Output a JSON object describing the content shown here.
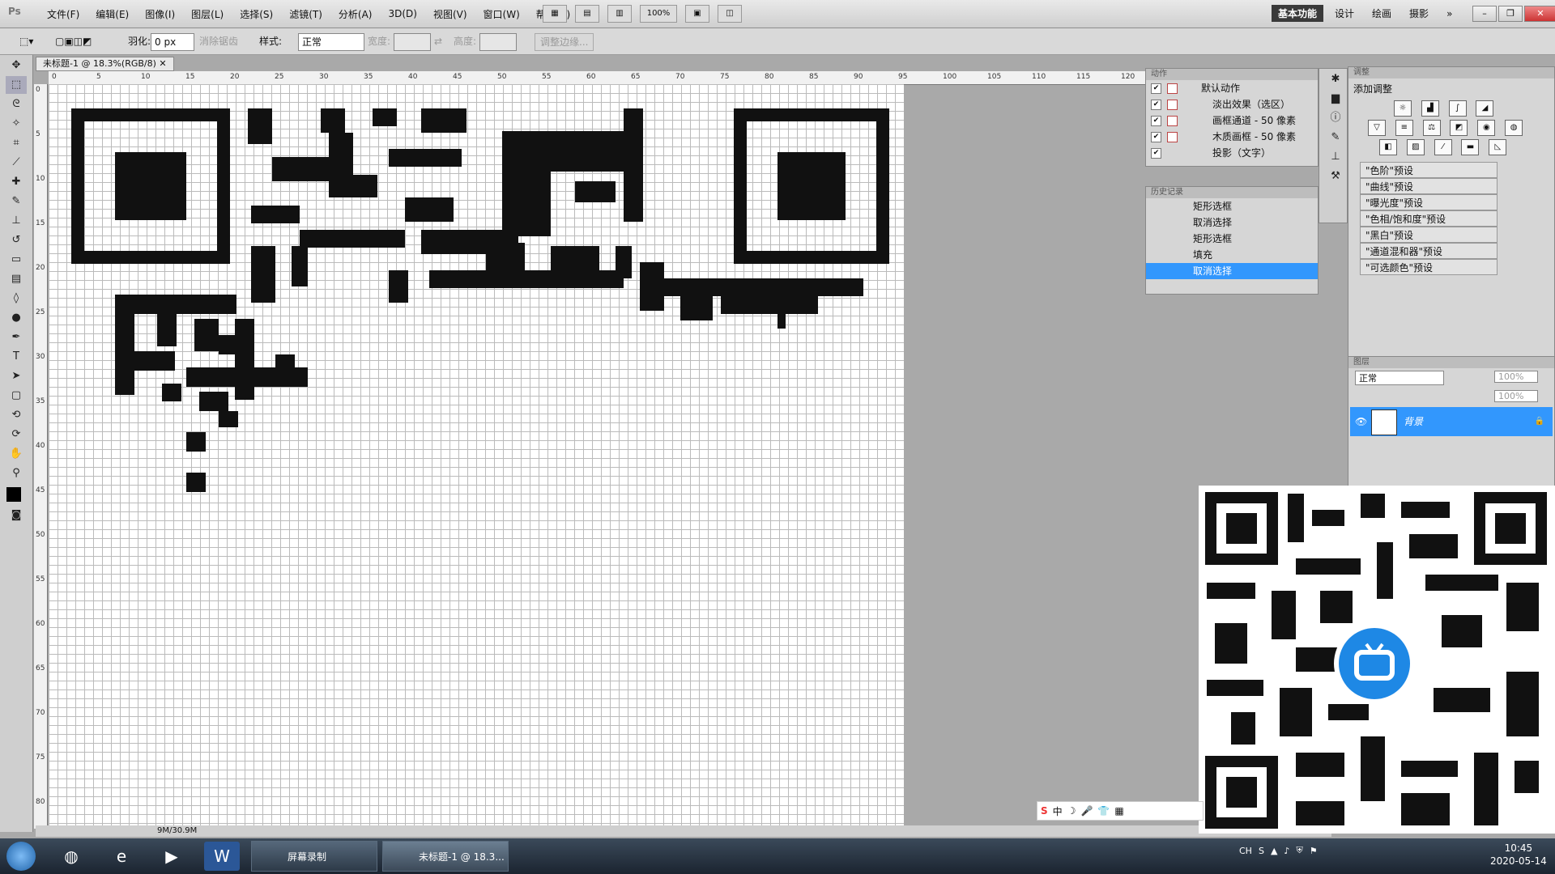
{
  "menubar": {
    "logo": "Ps",
    "items": [
      "文件(F)",
      "编辑(E)",
      "图像(I)",
      "图层(L)",
      "选择(S)",
      "滤镜(T)",
      "分析(A)",
      "3D(D)",
      "视图(V)",
      "窗口(W)",
      "帮助(H)"
    ],
    "zoom": "100%",
    "workspaces": [
      "基本功能",
      "设计",
      "绘画",
      "摄影"
    ],
    "active_workspace": "基本功能",
    "more": "»"
  },
  "options": {
    "feather_label": "羽化:",
    "feather_value": "0 px",
    "antialias_label": "消除锯齿",
    "style_label": "样式:",
    "style_value": "正常",
    "width_label": "宽度:",
    "height_label": "高度:",
    "refine_edge": "调整边缘..."
  },
  "document": {
    "tab_title": "未标题-1 @ 18.3%(RGB/8)",
    "status": "9M/30.9M",
    "ruler_h": [
      "0",
      "5",
      "10",
      "15",
      "20",
      "25",
      "30",
      "35",
      "40",
      "45",
      "50",
      "55",
      "60",
      "65",
      "70",
      "75",
      "80",
      "85",
      "90",
      "95",
      "100",
      "105",
      "110",
      "115",
      "120"
    ],
    "ruler_v": [
      "0",
      "5",
      "10",
      "15",
      "20",
      "25",
      "30",
      "35",
      "40",
      "45",
      "50",
      "55",
      "60",
      "65",
      "70",
      "75",
      "80"
    ]
  },
  "actions_panel": {
    "tab": "动作",
    "items": [
      {
        "label": "默认动作",
        "checked": true
      },
      {
        "label": "淡出效果（选区）",
        "checked": true
      },
      {
        "label": "画框通道 - 50 像素",
        "checked": true
      },
      {
        "label": "木质画框 - 50 像素",
        "checked": true
      },
      {
        "label": "投影（文字）",
        "checked": true
      }
    ]
  },
  "history_panel": {
    "tab": "历史记录",
    "items": [
      {
        "label": "矩形选框",
        "selected": false
      },
      {
        "label": "取消选择",
        "selected": false
      },
      {
        "label": "矩形选框",
        "selected": false
      },
      {
        "label": "填充",
        "selected": false
      },
      {
        "label": "取消选择",
        "selected": true
      }
    ]
  },
  "adjust_panel": {
    "tab": "调整",
    "title": "添加调整",
    "presets": [
      "\"色阶\"预设",
      "\"曲线\"预设",
      "\"曝光度\"预设",
      "\"色相/饱和度\"预设",
      "\"黑白\"预设",
      "\"通道混和器\"预设",
      "\"可选颜色\"预设"
    ]
  },
  "layers_panel": {
    "tab": "图层",
    "blend_mode": "正常",
    "opacity": "100%",
    "fill": "100%",
    "layer_name": "背景"
  },
  "ime": {
    "label": "中"
  },
  "taskbar": {
    "windows": [
      {
        "label": "屏幕录制"
      },
      {
        "label": "未标题-1 @ 18.3..."
      }
    ],
    "tray_lang": "CH",
    "time": "10:45",
    "date": "2020-05-14"
  },
  "colors": {
    "accent": "#3297fd",
    "foreground": "#000000",
    "bili_blue": "#1e88e5"
  }
}
